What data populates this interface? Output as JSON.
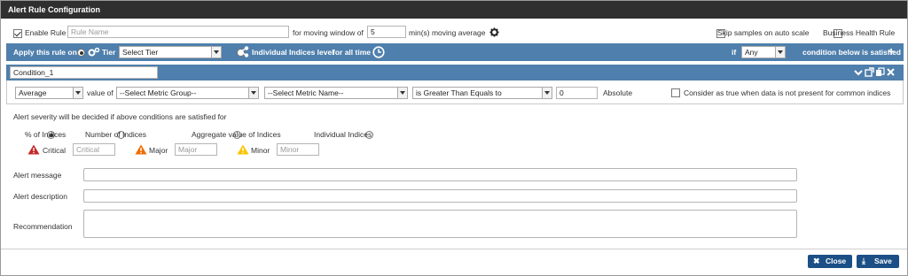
{
  "window": {
    "title": "Alert Rule Configuration"
  },
  "rule": {
    "enable_label": "Enable Rule",
    "enabled": true,
    "name_placeholder": "Rule Name",
    "moving_window_label": "for moving window of",
    "moving_window_value": "5",
    "moving_avg_label": "min(s) moving average",
    "skip_label": "Skip samples on auto scale",
    "business_label": "Business Health Rule"
  },
  "apply": {
    "label": "Apply this rule on",
    "tier_label": "Tier",
    "tier_select": "Select Tier",
    "indices_label": "Individual Indices level",
    "all_time": "for all time",
    "if_label": "if",
    "any_select": "Any",
    "cond_satisfied": "condition below is satisfied"
  },
  "condition": {
    "name": "Condition_1",
    "aggregate": "Average",
    "value_of": "value of",
    "metric_group": "--Select Metric Group--",
    "metric_name": "--Select Metric Name--",
    "operator": "is Greater Than Equals to",
    "threshold": "0",
    "absolute": "Absolute",
    "consider_label": "Consider as true when data is not present for common indices"
  },
  "severity": {
    "heading": "Alert severity will be decided if above conditions are satisfied for",
    "options": [
      "% of Indices",
      "Number of Indices",
      "Aggregate value of Indices",
      "Individual Indices"
    ],
    "critical_label": "Critical",
    "critical_placeholder": "Critical",
    "major_label": "Major",
    "major_placeholder": "Major",
    "minor_label": "Minor",
    "minor_placeholder": "Minor",
    "colors": {
      "critical": "#c62828",
      "major": "#ef6c00",
      "minor": "#f9c400"
    }
  },
  "fields": {
    "message_label": "Alert message",
    "description_label": "Alert description",
    "recommendation_label": "Recommendation"
  },
  "buttons": {
    "close": "Close",
    "save": "Save"
  },
  "theme": {
    "titlebar": "#2f2f2f",
    "bar": "#4f7fac",
    "button": "#1b4f86"
  }
}
